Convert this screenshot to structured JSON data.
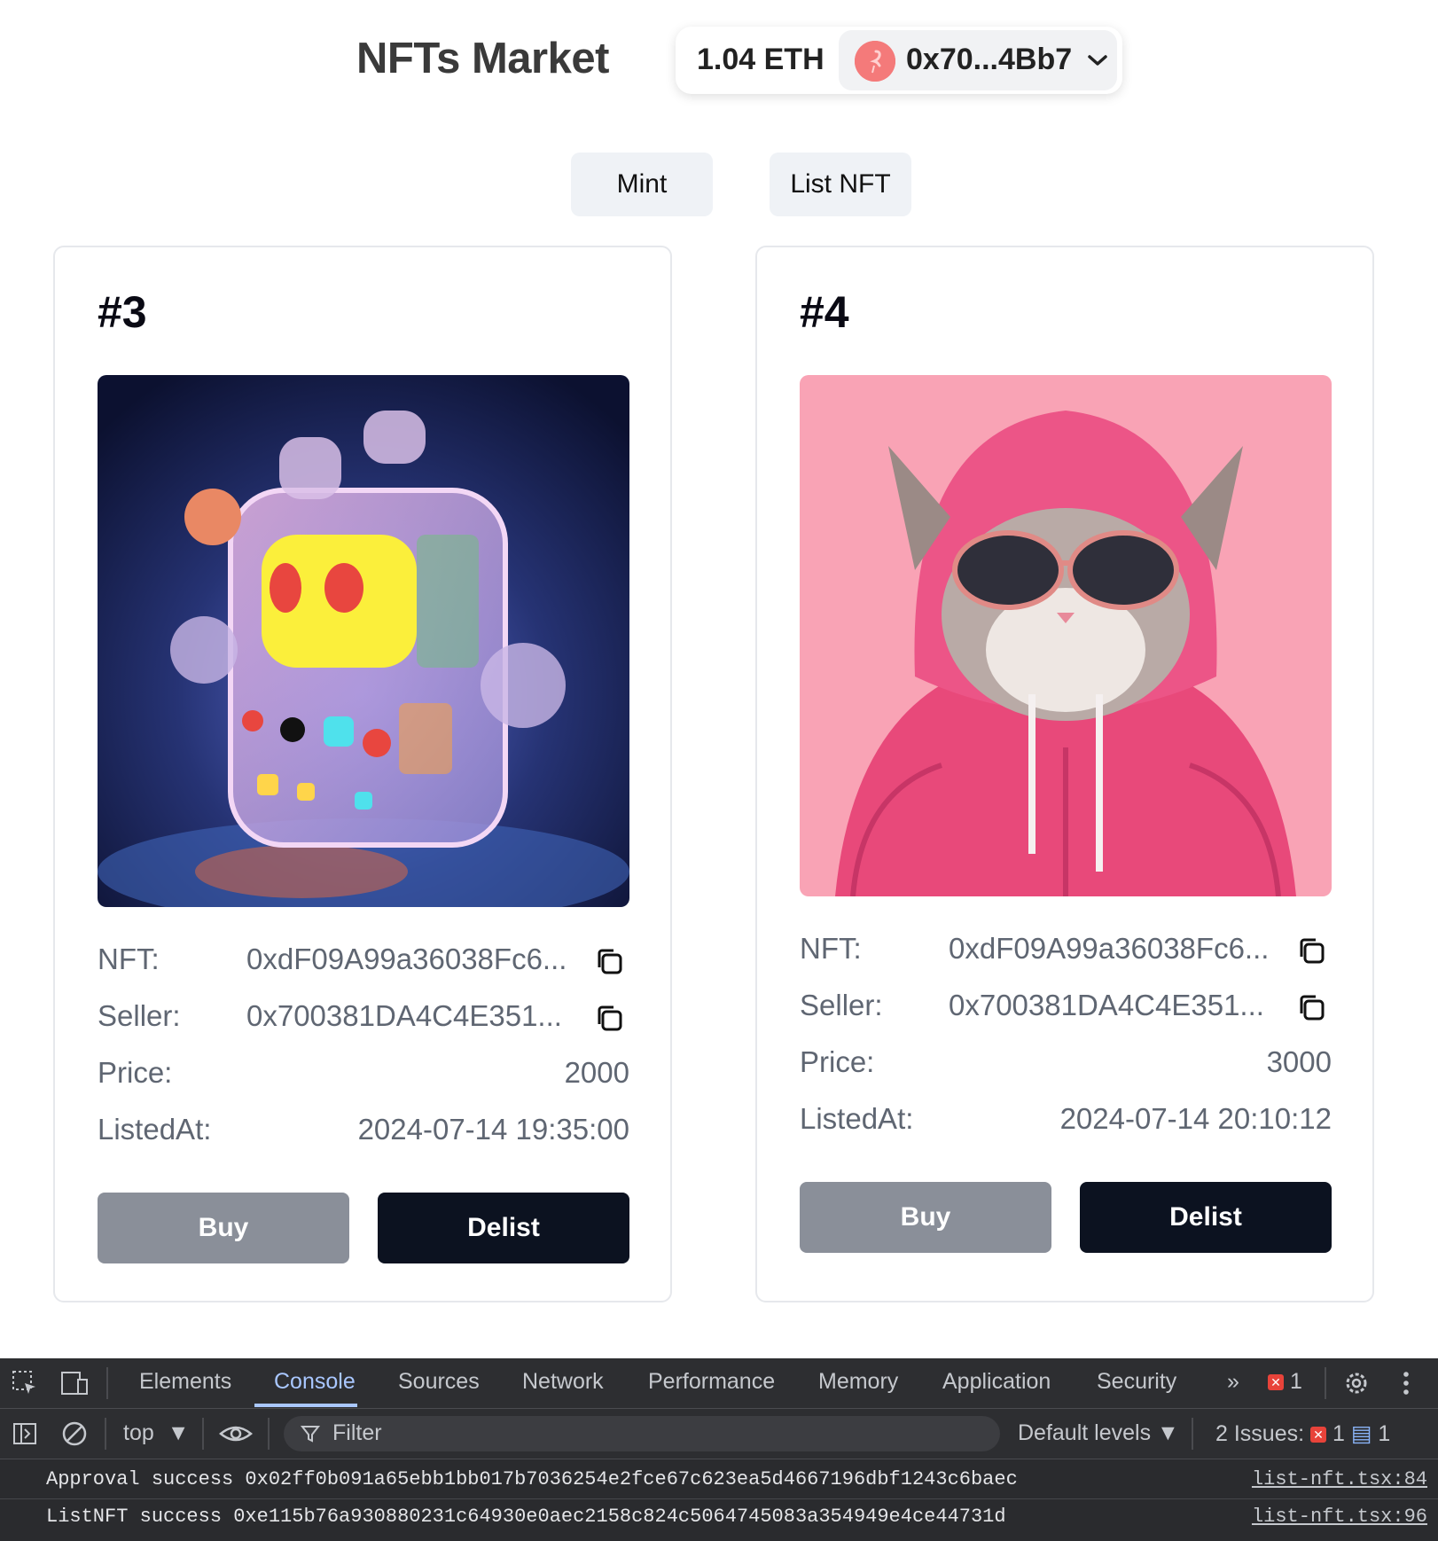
{
  "header": {
    "title": "NFTs Market",
    "balance": "1.04 ETH",
    "account_address": "0x70...4Bb7",
    "avatar_icon": "flamingo-icon"
  },
  "nav": {
    "mint_label": "Mint",
    "list_label": "List NFT"
  },
  "cards": [
    {
      "id": "#3",
      "image": "translucent-robot-art",
      "nft_label": "NFT:",
      "nft_value": "0xdF09A99a36038Fc6...",
      "seller_label": "Seller:",
      "seller_value": "0x700381DA4C4E351...",
      "price_label": "Price:",
      "price_value": "2000",
      "listed_label": "ListedAt:",
      "listed_value": "2024-07-14 19:35:00",
      "buy_label": "Buy",
      "delist_label": "Delist"
    },
    {
      "id": "#4",
      "image": "cat-pink-hoodie-art",
      "nft_label": "NFT:",
      "nft_value": "0xdF09A99a36038Fc6...",
      "seller_label": "Seller:",
      "seller_value": "0x700381DA4C4E351...",
      "price_label": "Price:",
      "price_value": "3000",
      "listed_label": "ListedAt:",
      "listed_value": "2024-07-14 20:10:12",
      "buy_label": "Buy",
      "delist_label": "Delist"
    }
  ],
  "devtools": {
    "tabs": [
      "Elements",
      "Console",
      "Sources",
      "Network",
      "Performance",
      "Memory",
      "Application",
      "Security"
    ],
    "active_tab": "Console",
    "error_count": "1",
    "context": "top",
    "filter_placeholder": "Filter",
    "levels": "Default levels",
    "issues_label": "2 Issues:",
    "issues_error_count": "1",
    "issues_info_count": "1",
    "logs": [
      {
        "text": "Approval success 0x02ff0b091a65ebb1bb017b7036254e2fce67c623ea5d4667196dbf1243c6baec",
        "source": "list-nft.tsx:84"
      },
      {
        "text": "ListNFT success 0xe115b76a930880231c64930e0aec2158c824c5064745083a354949e4ce44731d",
        "source": "list-nft.tsx:96"
      }
    ]
  },
  "colors": {
    "delist_button": "#0c1220",
    "buy_button": "#8a8f99",
    "devtools_bg": "#2a2b2e",
    "active_tab": "#a9c7ff"
  }
}
